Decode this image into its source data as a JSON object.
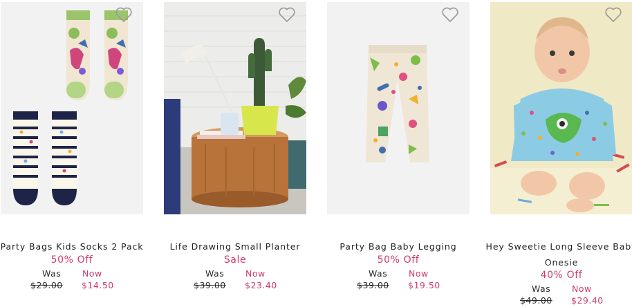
{
  "products": [
    {
      "name": "Party Bags Kids Socks 2 Pack",
      "promo": "50% Off",
      "was_label": "Was",
      "was_price": "$29.00",
      "now_label": "Now",
      "now_price": "$14.50"
    },
    {
      "name": "Life Drawing Small Planter",
      "promo": "Sale",
      "was_label": "Was",
      "was_price": "$39.00",
      "now_label": "Now",
      "now_price": "$23.40"
    },
    {
      "name": "Party Bag Baby Legging",
      "promo": "50% Off",
      "was_label": "Was",
      "was_price": "$39.00",
      "now_label": "Now",
      "now_price": "$19.50"
    },
    {
      "name_line1": "Hey Sweetie Long Sleeve Baby",
      "name_line2": "Onesie",
      "promo": "40% Off",
      "was_label": "Was",
      "was_price": "$49.00",
      "now_label": "Now",
      "now_price": "$29.40"
    }
  ],
  "colors": {
    "sale_pink": "#d03a6d",
    "text": "#222222",
    "image_bg": "#f2f2f2"
  },
  "icons": {
    "wishlist": "heart-outline-icon"
  }
}
